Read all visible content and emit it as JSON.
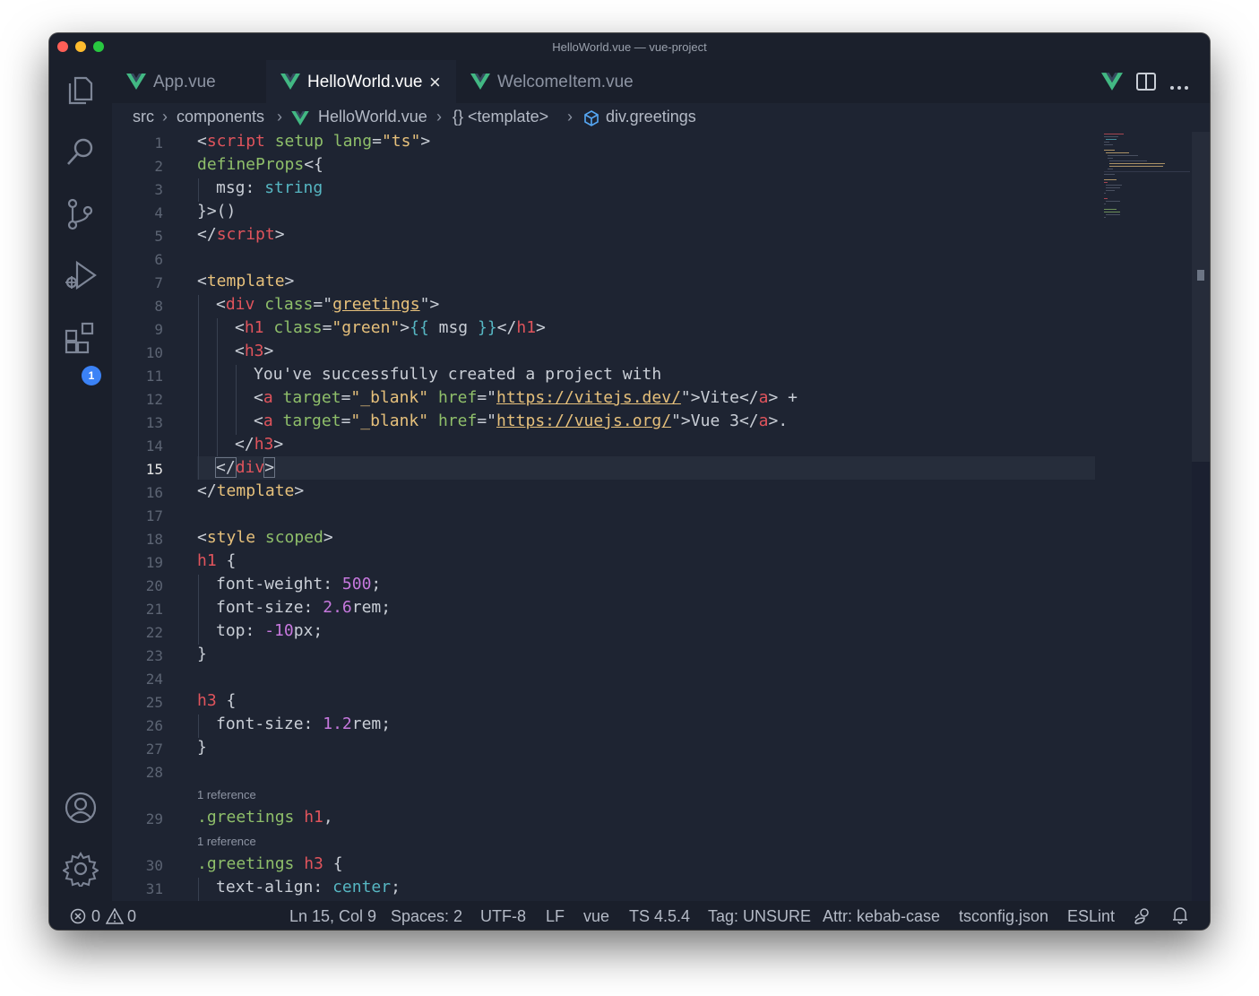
{
  "window": {
    "title": "HelloWorld.vue — vue-project"
  },
  "activity": {
    "extensions_badge": "1"
  },
  "tabs": [
    {
      "label": "App.vue"
    },
    {
      "label": "HelloWorld.vue"
    },
    {
      "label": "WelcomeItem.vue"
    }
  ],
  "breadcrumb": {
    "src": "src",
    "components": "components",
    "file": "HelloWorld.vue",
    "template": "{} <template>",
    "element": "div.greetings"
  },
  "editor": {
    "line_numbers": [
      "1",
      "2",
      "3",
      "4",
      "5",
      "6",
      "7",
      "8",
      "9",
      "10",
      "11",
      "12",
      "13",
      "14",
      "15",
      "16",
      "17",
      "18",
      "19",
      "20",
      "21",
      "22",
      "23",
      "24",
      "25",
      "26",
      "27",
      "28",
      "29",
      "30",
      "31"
    ],
    "current_line": "15",
    "code_lens": [
      "1 reference",
      "1 reference"
    ],
    "lines": {
      "l1": [
        "<",
        "script",
        " ",
        "setup",
        " ",
        "lang",
        "=",
        "\"ts\"",
        ">"
      ],
      "l2": [
        "defineProps",
        "<{"
      ],
      "l3": [
        "msg",
        ": ",
        "string"
      ],
      "l4": [
        "}>()"
      ],
      "l5": [
        "</",
        "script",
        ">"
      ],
      "l7": [
        "<",
        "template",
        ">"
      ],
      "l8": [
        "<",
        "div",
        " ",
        "class",
        "=\"",
        "greetings",
        "\">"
      ],
      "l9": [
        "<",
        "h1",
        " ",
        "class",
        "=",
        "\"green\"",
        ">",
        "{{",
        " msg ",
        "}}",
        "</",
        "h1",
        ">"
      ],
      "l10": [
        "<",
        "h3",
        ">"
      ],
      "l11": [
        "You've successfully created a project with"
      ],
      "l12": [
        "<",
        "a",
        " ",
        "target",
        "=",
        "\"_blank\"",
        " ",
        "href",
        "=\"",
        "https://vitejs.dev/",
        "\">",
        "Vite",
        "</",
        "a",
        ">",
        " +"
      ],
      "l13": [
        "<",
        "a",
        " ",
        "target",
        "=",
        "\"_blank\"",
        " ",
        "href",
        "=\"",
        "https://vuejs.org/",
        "\">",
        "Vue 3",
        "</",
        "a",
        ">",
        "."
      ],
      "l14": [
        "</",
        "h3",
        ">"
      ],
      "l15": [
        "</",
        "div",
        ">"
      ],
      "l16": [
        "</",
        "template",
        ">"
      ],
      "l18": [
        "<",
        "style",
        " ",
        "scoped",
        ">"
      ],
      "l19": [
        "h1",
        " {"
      ],
      "l20": [
        "font-weight",
        ": ",
        "500",
        ";"
      ],
      "l21": [
        "font-size",
        ": ",
        "2.6",
        "rem;"
      ],
      "l22": [
        "top",
        ": ",
        "-10",
        "px;"
      ],
      "l23": [
        "}"
      ],
      "l25": [
        "h3",
        " {"
      ],
      "l26": [
        "font-size",
        ": ",
        "1.2",
        "rem;"
      ],
      "l27": [
        "}"
      ],
      "l29": [
        ".greetings",
        " ",
        "h1",
        ","
      ],
      "l30": [
        ".greetings",
        " ",
        "h3",
        " {"
      ],
      "l31": [
        "text-align",
        ": ",
        "center",
        ";"
      ]
    }
  },
  "statusbar": {
    "errors": "0",
    "warnings": "0",
    "position": "Ln 15, Col 9",
    "spaces": "Spaces: 2",
    "encoding": "UTF-8",
    "eol": "LF",
    "language": "vue",
    "ts": "TS 4.5.4",
    "tag": "Tag: UNSURE",
    "attr": "Attr: kebab-case",
    "tsconfig": "tsconfig.json",
    "eslint": "ESLint"
  },
  "colors": {
    "background": "#1e2432",
    "vue_green": "#42b883",
    "tag": "#e0545c",
    "string": "#e6c07b",
    "type": "#56b6c2",
    "number": "#c678dd",
    "function": "#8fbf6a"
  }
}
